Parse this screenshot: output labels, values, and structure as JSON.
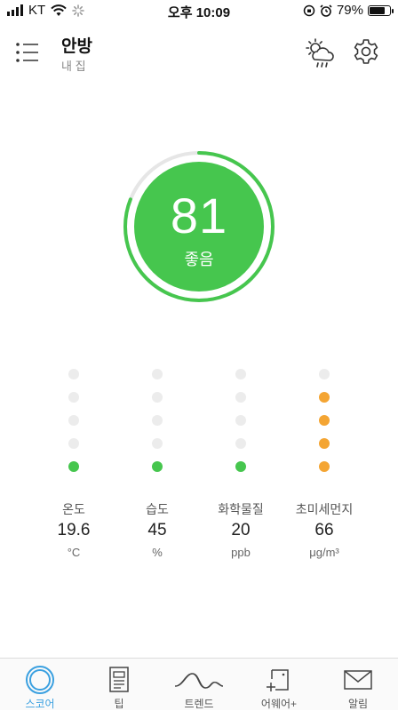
{
  "status_bar": {
    "carrier": "KT",
    "time": "오후 10:09",
    "battery_percent": "79%",
    "battery_level": 0.79
  },
  "header": {
    "title": "안방",
    "subtitle": "내 집",
    "icons": {
      "menu": "menu-list-icon",
      "weather": "partly-cloudy-rain-icon",
      "settings": "gear-icon"
    }
  },
  "score": {
    "value": "81",
    "label": "좋음",
    "progress": 0.81,
    "color": "#46c64e",
    "track_color": "#e6e6e6"
  },
  "metrics": [
    {
      "label": "온도",
      "value": "19.6",
      "unit": "°C",
      "level": 1,
      "color": "#46c64e"
    },
    {
      "label": "습도",
      "value": "45",
      "unit": "%",
      "level": 1,
      "color": "#46c64e"
    },
    {
      "label": "화학물질",
      "value": "20",
      "unit": "ppb",
      "level": 1,
      "color": "#46c64e"
    },
    {
      "label": "초미세먼지",
      "value": "66",
      "unit": "μg/m³",
      "level": 4,
      "color": "#f4a533"
    }
  ],
  "tabs": [
    {
      "label": "스코어",
      "icon": "score-ring-icon",
      "active": true
    },
    {
      "label": "팁",
      "icon": "document-icon",
      "active": false
    },
    {
      "label": "트렌드",
      "icon": "trend-wave-icon",
      "active": false
    },
    {
      "label": "어웨어+",
      "icon": "add-device-icon",
      "active": false
    },
    {
      "label": "알림",
      "icon": "mail-icon",
      "active": false
    }
  ]
}
